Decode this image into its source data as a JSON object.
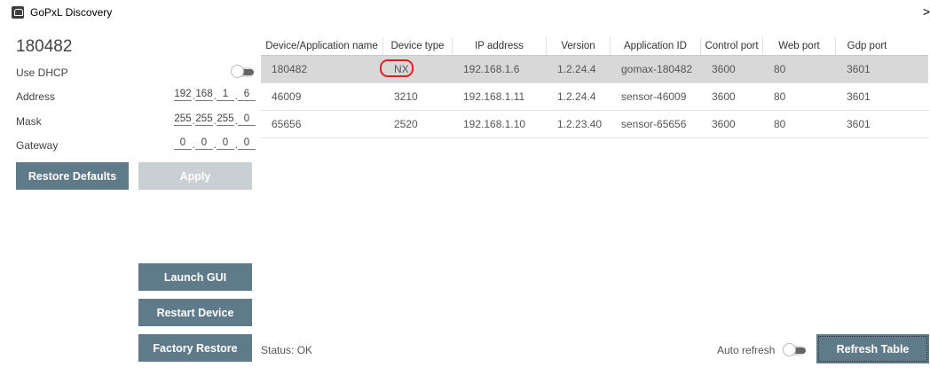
{
  "window": {
    "title": "GoPxL Discovery",
    "close_glyph": ">"
  },
  "left": {
    "device_name": "180482",
    "use_dhcp_label": "Use DHCP",
    "address_label": "Address",
    "address": [
      "192",
      "168",
      "1",
      "6"
    ],
    "mask_label": "Mask",
    "mask": [
      "255",
      "255",
      "255",
      "0"
    ],
    "gateway_label": "Gateway",
    "gateway": [
      "0",
      "0",
      "0",
      "0"
    ],
    "restore_defaults": "Restore Defaults",
    "apply": "Apply",
    "launch_gui": "Launch GUI",
    "restart_device": "Restart Device",
    "factory_restore": "Factory Restore"
  },
  "table": {
    "headers": [
      "Device/Application name",
      "Device type",
      "IP address",
      "Version",
      "Application ID",
      "Control port",
      "Web port",
      "Gdp port"
    ],
    "rows": [
      [
        "180482",
        "NX",
        "192.168.1.6",
        "1.2.24.4",
        "gomax-180482",
        "3600",
        "80",
        "3601"
      ],
      [
        "46009",
        "3210",
        "192.168.1.11",
        "1.2.24.4",
        "sensor-46009",
        "3600",
        "80",
        "3601"
      ],
      [
        "65656",
        "2520",
        "192.168.1.10",
        "1.2.23.40",
        "sensor-65656",
        "3600",
        "80",
        "3601"
      ]
    ]
  },
  "footer": {
    "status": "Status:  OK",
    "auto_refresh_label": "Auto refresh",
    "refresh_table": "Refresh Table"
  }
}
